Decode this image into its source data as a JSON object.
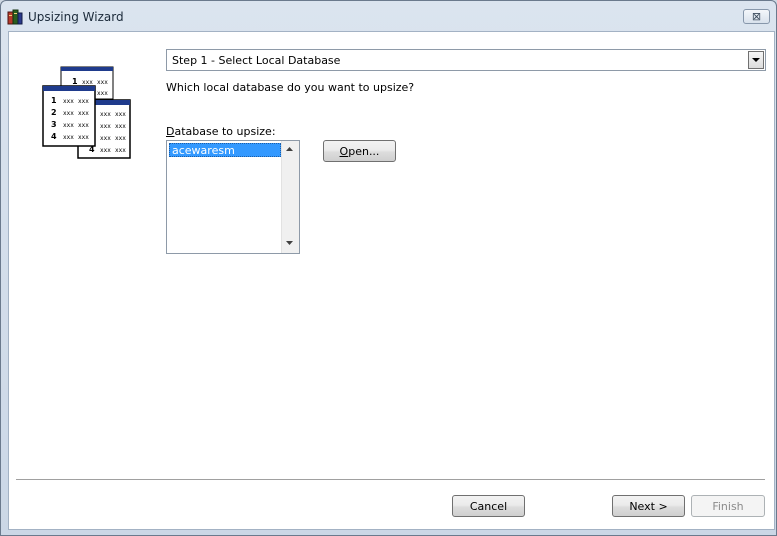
{
  "window": {
    "title": "Upsizing Wizard",
    "close_glyph": "⊠"
  },
  "step_select": {
    "value": "Step 1 - Select Local Database"
  },
  "question": "Which local database do you want to upsize?",
  "database_list": {
    "label_first": "D",
    "label_rest": "atabase to upsize:",
    "items": [
      "acewaresm"
    ],
    "selected_index": 0
  },
  "open_button": {
    "label_first": "O",
    "label_rest": "pen..."
  },
  "footer": {
    "cancel_label": "Cancel",
    "next_label": "Next >",
    "finish_label": "Finish"
  },
  "illustration": {
    "icon": "database-tables-icon",
    "row_numbers": [
      "1",
      "2",
      "3",
      "4"
    ],
    "cell_text": "xxx"
  },
  "colors": {
    "selection": "#3399ff",
    "titlebar": "#dbe4ef"
  }
}
